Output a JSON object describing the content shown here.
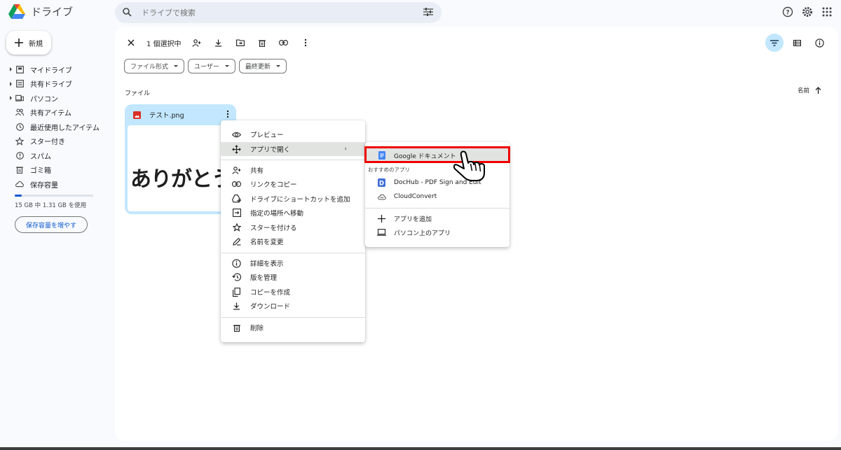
{
  "app": {
    "name": "ドライブ"
  },
  "search": {
    "placeholder": "ドライブで検索"
  },
  "sidebar": {
    "new_label": "新規",
    "items": [
      {
        "label": "マイドライブ",
        "icon": "my-drive-icon",
        "expandable": true
      },
      {
        "label": "共有ドライブ",
        "icon": "shared-drive-icon",
        "expandable": true
      },
      {
        "label": "パソコン",
        "icon": "computer-icon",
        "expandable": true
      },
      {
        "label": "共有アイテム",
        "icon": "people-icon",
        "expandable": false
      },
      {
        "label": "最近使用したアイテム",
        "icon": "clock-icon",
        "expandable": false
      },
      {
        "label": "スター付き",
        "icon": "star-icon",
        "expandable": false
      },
      {
        "label": "スパム",
        "icon": "spam-icon",
        "expandable": false
      },
      {
        "label": "ゴミ箱",
        "icon": "trash-icon",
        "expandable": false
      },
      {
        "label": "保存容量",
        "icon": "cloud-icon",
        "expandable": false
      }
    ],
    "storage_text": "15 GB 中 1.31 GB を使用",
    "storage_fraction": 0.087,
    "storage_button": "保存容量を増やす"
  },
  "toolbar": {
    "selected": "1 個選択中"
  },
  "filters": [
    "ファイル形式",
    "ユーザー",
    "最終更新"
  ],
  "section_title": "ファイル",
  "sort_label": "名前",
  "file": {
    "name": "テスト.png",
    "preview_text": "ありがとう"
  },
  "context_menu": {
    "preview": "プレビュー",
    "open_with": "アプリで開く",
    "share": "共有",
    "copy_link": "リンクをコピー",
    "add_shortcut": "ドライブにショートカットを追加",
    "move": "指定の場所へ移動",
    "star": "スターを付ける",
    "rename": "名前を変更",
    "details": "詳細を表示",
    "versions": "版を管理",
    "make_copy": "コピーを作成",
    "download": "ダウンロード",
    "delete": "削除"
  },
  "submenu": {
    "google_docs": "Google ドキュメント",
    "suggested_heading": "おすすめのアプリ",
    "dochub": "DocHub - PDF Sign and Edit",
    "cloudconvert": "CloudConvert",
    "add_app": "アプリを追加",
    "computer_apps": "パソコン上のアプリ"
  },
  "colors": {
    "accent": "#0b57d0",
    "selected": "#c2e7ff",
    "highlight_box": "#ee0000"
  }
}
